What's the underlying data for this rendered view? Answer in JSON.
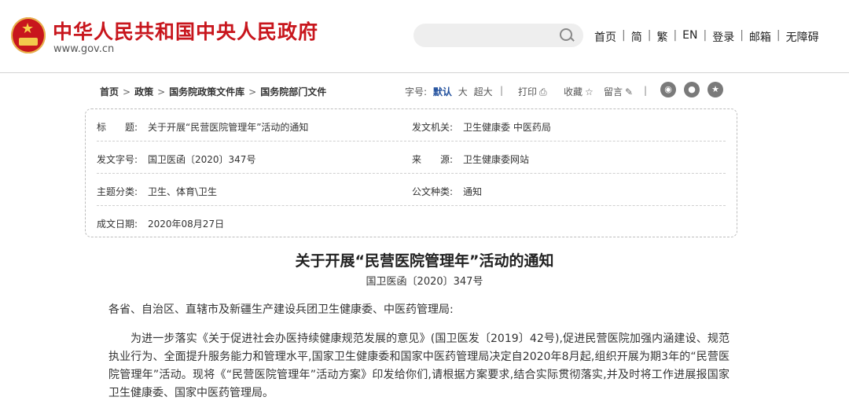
{
  "header": {
    "site_title": "中华人民共和国中央人民政府",
    "site_url": "www.gov.cn",
    "nav": [
      "首页",
      "简",
      "繁",
      "EN",
      "登录",
      "邮箱",
      "无障碍"
    ],
    "nav_separator": "|"
  },
  "toolbar": {
    "breadcrumb": [
      "首页",
      "政策",
      "国务院政策文件库",
      "国务院部门文件"
    ],
    "breadcrumb_separator": ">",
    "fontsize_label": "字号:",
    "fontsize_options": [
      "默认",
      "大",
      "超大"
    ],
    "print_label": "打印",
    "favorite_label": "收藏",
    "comment_label": "留言",
    "separator": "|"
  },
  "info": {
    "title_label": "标　　题:",
    "title_value": "关于开展“民营医院管理年”活动的通知",
    "issuer_label": "发文机关:",
    "issuer_value": "卫生健康委  中医药局",
    "doc_no_label": "发文字号:",
    "doc_no_value": "国卫医函〔2020〕347号",
    "source_label": "来　　源:",
    "source_value": "卫生健康委网站",
    "category_label": "主题分类:",
    "category_value": "卫生、体育\\卫生",
    "type_label": "公文种类:",
    "type_value": "通知",
    "date_label": "成文日期:",
    "date_value": "2020年08月27日"
  },
  "document": {
    "title": "关于开展“民营医院管理年”活动的通知",
    "number": "国卫医函〔2020〕347号",
    "addressee": "各省、自治区、直辖市及新疆生产建设兵团卫生健康委、中医药管理局:",
    "paragraph": "为进一步落实《关于促进社会办医持续健康规范发展的意见》(国卫医发〔2019〕42号),促进民营医院加强内涵建设、规范执业行为、全面提升服务能力和管理水平,国家卫生健康委和国家中医药管理局决定自2020年8月起,组织开展为期3年的“民营医院管理年”活动。现将《“民营医院管理年”活动方案》印发给你们,请根据方案要求,结合实际贯彻落实,并及时将工作进展报国家卫生健康委、国家中医药管理局。"
  },
  "colors": {
    "brand_red": "#c8161d",
    "link_blue": "#1f4e9c"
  }
}
